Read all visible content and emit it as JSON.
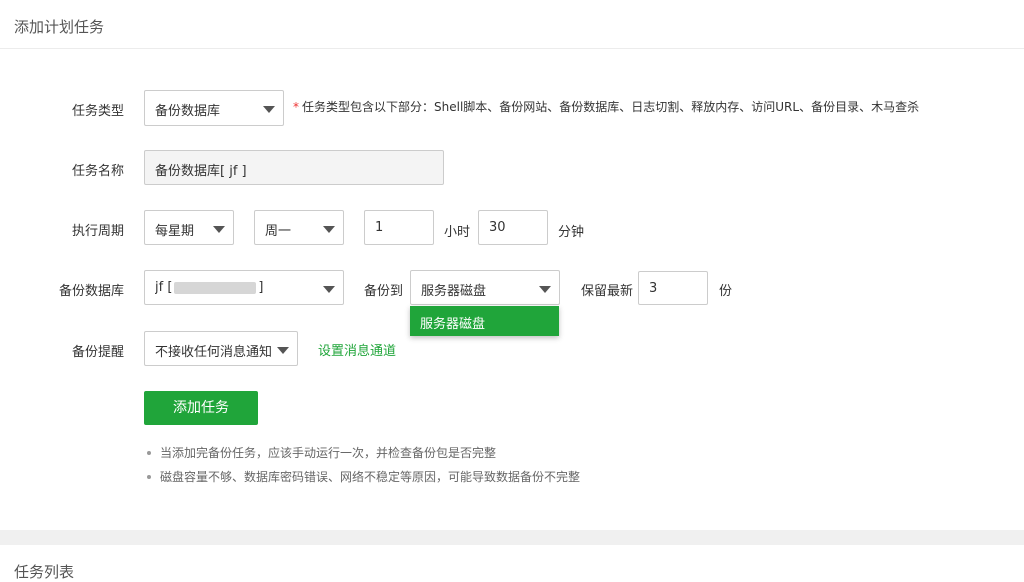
{
  "header": {
    "title": "添加计划任务"
  },
  "form": {
    "task_type": {
      "label": "任务类型",
      "value": "备份数据库",
      "hint_star": "*",
      "hint": "任务类型包含以下部分：Shell脚本、备份网站、备份数据库、日志切割、释放内存、访问URL、备份目录、木马查杀"
    },
    "task_name": {
      "label": "任务名称",
      "value": "备份数据库[ jf ]"
    },
    "cycle": {
      "label": "执行周期",
      "period": "每星期",
      "weekday": "周一",
      "hour": "1",
      "hour_unit": "小时",
      "minute": "30",
      "minute_unit": "分钟"
    },
    "backup_db": {
      "label": "备份数据库",
      "value_prefix": "jf [",
      "value_suffix": "]",
      "backup_to_label": "备份到",
      "backup_to_value": "服务器磁盘",
      "dropdown_option": "服务器磁盘",
      "keep_label": "保留最新",
      "keep_value": "3",
      "keep_unit": "份"
    },
    "notify": {
      "label": "备份提醒",
      "value": "不接收任何消息通知",
      "link": "设置消息通道"
    },
    "submit_label": "添加任务",
    "notes": [
      "当添加完备份任务，应该手动运行一次，并检查备份包是否完整",
      "磁盘容量不够、数据库密码错误、网络不稳定等原因，可能导致数据备份不完整"
    ]
  },
  "task_list": {
    "title": "任务列表"
  },
  "colors": {
    "accent": "#20a53a",
    "required_star": "#ee3333"
  }
}
